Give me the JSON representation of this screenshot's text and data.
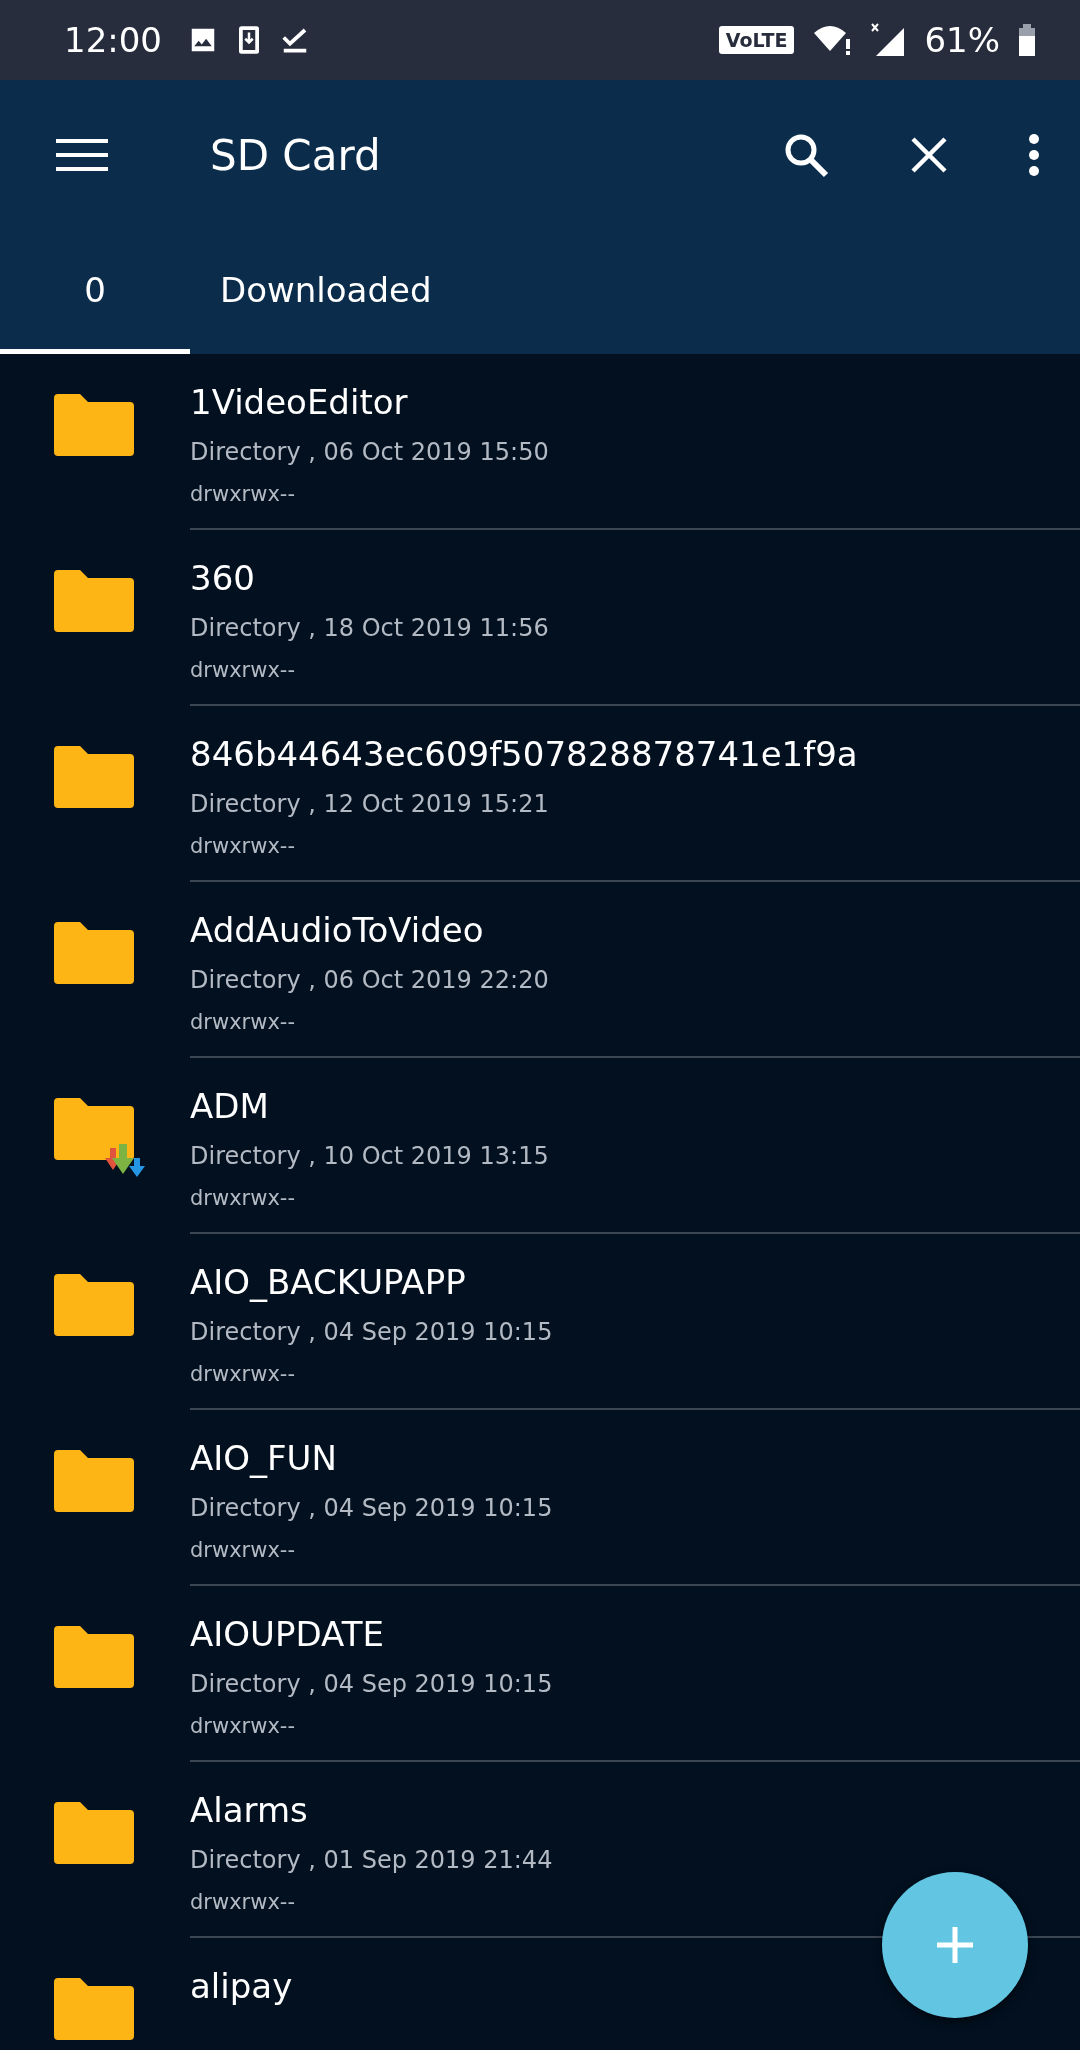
{
  "status_bar": {
    "time": "12:00",
    "network": "VoLTE",
    "battery": "61%"
  },
  "toolbar": {
    "title": "SD Card"
  },
  "tabs": [
    {
      "label": "0",
      "selected": true
    },
    {
      "label": "Downloaded",
      "selected": false
    }
  ],
  "files": [
    {
      "kind": "folder",
      "name": "1VideoEditor",
      "details": "Directory , 06 Oct 2019 15:50",
      "permissions": "drwxrwx--"
    },
    {
      "kind": "folder",
      "name": "360",
      "details": "Directory , 18 Oct 2019 11:56",
      "permissions": "drwxrwx--"
    },
    {
      "kind": "folder",
      "name": "846b44643ec609f507828878741e1f9a",
      "details": "Directory , 12 Oct 2019 15:21",
      "permissions": "drwxrwx--"
    },
    {
      "kind": "folder",
      "name": "AddAudioToVideo",
      "details": "Directory , 06 Oct 2019 22:20",
      "permissions": "drwxrwx--"
    },
    {
      "kind": "download-folder",
      "name": "ADM",
      "details": "Directory , 10 Oct 2019 13:15",
      "permissions": "drwxrwx--"
    },
    {
      "kind": "folder",
      "name": "AIO_BACKUPAPP",
      "details": "Directory , 04 Sep 2019 10:15",
      "permissions": "drwxrwx--"
    },
    {
      "kind": "folder",
      "name": "AIO_FUN",
      "details": "Directory , 04 Sep 2019 10:15",
      "permissions": "drwxrwx--"
    },
    {
      "kind": "folder",
      "name": "AIOUPDATE",
      "details": "Directory , 04 Sep 2019 10:15",
      "permissions": "drwxrwx--"
    },
    {
      "kind": "folder",
      "name": "Alarms",
      "details": "Directory , 01 Sep 2019 21:44",
      "permissions": "drwxrwx--"
    },
    {
      "kind": "folder",
      "name": "alipay"
    }
  ]
}
